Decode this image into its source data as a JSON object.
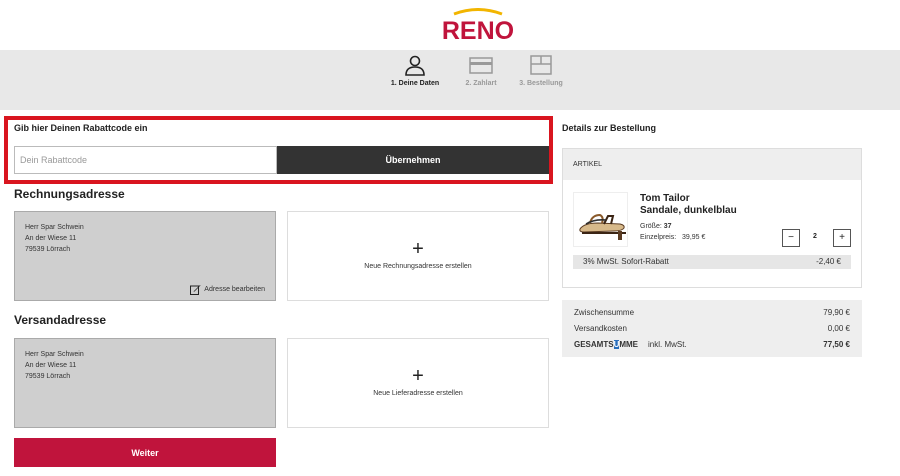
{
  "brand": {
    "name": "RENO",
    "color": "#c0143c",
    "accent": "#f2b500"
  },
  "stepper": [
    {
      "label": "1. Deine Daten",
      "icon": "user-icon",
      "active": true
    },
    {
      "label": "2. Zahlart",
      "icon": "credit-card-icon",
      "active": false
    },
    {
      "label": "3. Bestellung",
      "icon": "box-icon",
      "active": false
    }
  ],
  "promo": {
    "title": "Gib hier Deinen Rabattcode ein",
    "placeholder": "Dein Rabattcode",
    "button_label": "Übernehmen",
    "highlight_color": "#d9151f"
  },
  "billing": {
    "heading": "Rechnungsadresse",
    "address": {
      "name": "Herr Spar Schwein",
      "street": "An der Wiese 11",
      "city": "79539 Lörrach"
    },
    "edit_label": "Adresse bearbeiten",
    "new_label": "Neue Rechnungsadresse erstellen"
  },
  "shipping": {
    "heading": "Versandadresse",
    "address": {
      "name": "Herr Spar Schwein",
      "street": "An der Wiese 11",
      "city": "79539 Lörrach"
    },
    "new_label": "Neue Lieferadresse erstellen"
  },
  "next_label": "Weiter",
  "order": {
    "title": "Details zur Bestellung",
    "column_header": "ARTIKEL",
    "product": {
      "brand": "Tom Tailor",
      "name": "Sandale, dunkelblau",
      "size_label": "Größe:",
      "size": "37",
      "unit_price_label": "Einzelpreis:",
      "unit_price": "39,95 €",
      "quantity": "2",
      "minus": "−",
      "plus": "+"
    },
    "discount": {
      "label": "3% MwSt. Sofort-Rabatt",
      "value": "-2,40 €"
    },
    "totals": {
      "subtotal_label": "Zwischensumme",
      "subtotal": "79,90 €",
      "shipping_label": "Versandkosten",
      "shipping": "0,00 €",
      "grand_label_a": "GESAMTS",
      "grand_label_sel": "U",
      "grand_label_b": "MME",
      "incl_label": "inkl. MwSt.",
      "grand": "77,50 €"
    }
  }
}
